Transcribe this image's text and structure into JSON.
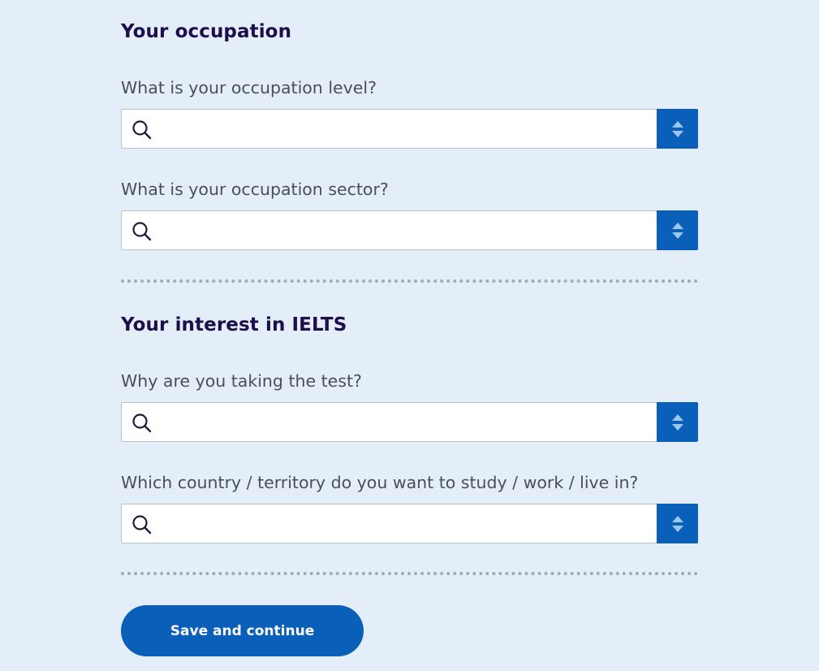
{
  "sections": [
    {
      "title": "Your occupation",
      "fields": [
        {
          "label": "What is your occupation level?",
          "value": "",
          "placeholder": ""
        },
        {
          "label": "What is your occupation sector?",
          "value": "",
          "placeholder": ""
        }
      ]
    },
    {
      "title": "Your interest in IELTS",
      "fields": [
        {
          "label": "Why are you taking the test?",
          "value": "",
          "placeholder": ""
        },
        {
          "label": "Which country / territory do you want to study / work / live in?",
          "value": "",
          "placeholder": ""
        }
      ]
    }
  ],
  "actions": {
    "save_label": "Save and continue"
  },
  "colors": {
    "background": "#e3eef8",
    "heading": "#1e0f4c",
    "label": "#4a4f58",
    "accent": "#0a5fb8",
    "divider": "#9eabba"
  },
  "icons": {
    "field_left": "search-icon",
    "field_right": "sort-arrows-icon"
  }
}
